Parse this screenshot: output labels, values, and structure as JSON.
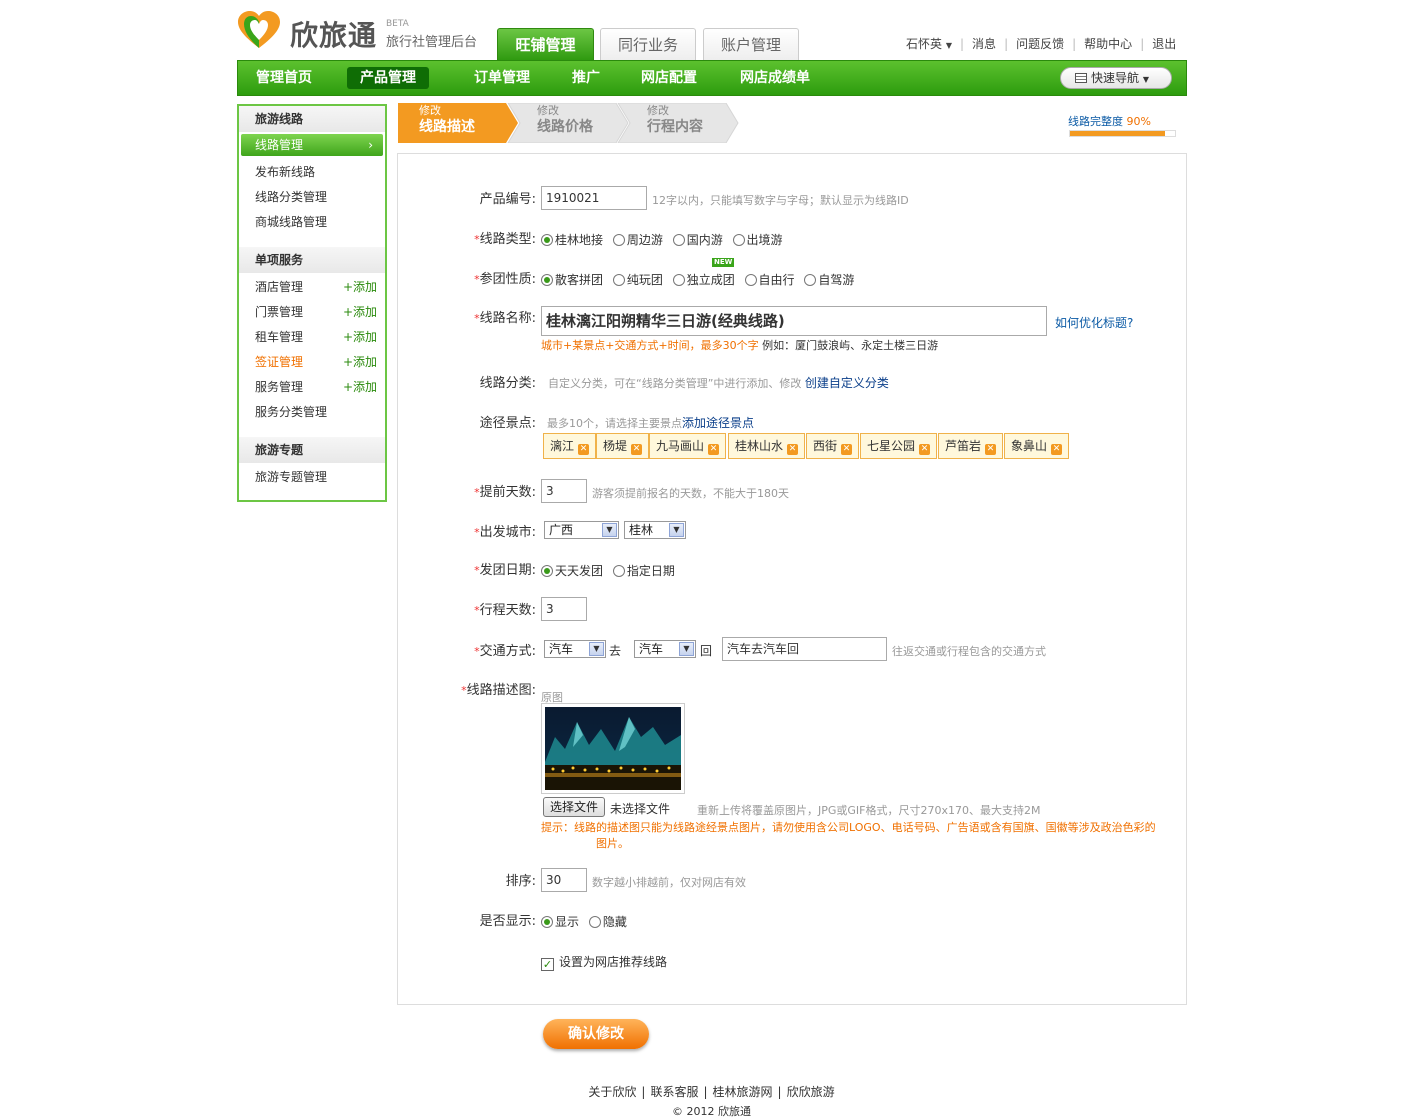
{
  "brand": {
    "logo_text": "欣旅通",
    "beta": "BETA",
    "subtitle": "旅行社管理后台"
  },
  "top_tabs": [
    "旺铺管理",
    "同行业务",
    "账户管理"
  ],
  "top_links": {
    "user": "石怀英",
    "messages": "消息",
    "feedback": "问题反馈",
    "help": "帮助中心",
    "logout": "退出"
  },
  "nav": {
    "items": [
      "管理首页",
      "产品管理",
      "订单管理",
      "推广",
      "网店配置",
      "网店成绩单"
    ],
    "quick_nav": "快速导航"
  },
  "sidebar": {
    "sections": [
      {
        "title": "旅游线路",
        "items": [
          "线路管理",
          "发布新线路",
          "线路分类管理",
          "商城线路管理"
        ]
      },
      {
        "title": "单项服务",
        "items": [
          "酒店管理",
          "门票管理",
          "租车管理",
          "签证管理",
          "服务管理",
          "服务分类管理"
        ],
        "add": "+添加"
      },
      {
        "title": "旅游专题",
        "items": [
          "旅游专题管理"
        ]
      }
    ]
  },
  "steps": [
    {
      "top": "修改",
      "main": "线路描述"
    },
    {
      "top": "修改",
      "main": "线路价格"
    },
    {
      "top": "修改",
      "main": "行程内容"
    }
  ],
  "completion": {
    "label": "线路完整度",
    "value": "90%",
    "fraction": 0.9
  },
  "form": {
    "product_no": {
      "label": "产品编号:",
      "value": "1910021",
      "hint": "12字以内，只能填写数字与字母；默认显示为线路ID"
    },
    "route_type": {
      "label": "线路类型:",
      "options": [
        "桂林地接",
        "周边游",
        "国内游",
        "出境游"
      ],
      "selected": 0
    },
    "group_type": {
      "label": "参团性质:",
      "options": [
        "散客拼团",
        "纯玩团",
        "独立成团",
        "自由行",
        "自驾游"
      ],
      "selected": 0,
      "new_badge": "NEW"
    },
    "route_name": {
      "label": "线路名称:",
      "value": "桂林漓江阳朔精华三日游(经典线路)",
      "help_link": "如何优化标题?",
      "hint_red": "城市+某景点+交通方式+时间，最多30个字",
      "hint_example": "例如：厦门鼓浪屿、永定土楼三日游"
    },
    "category": {
      "label": "线路分类:",
      "hint": "自定义分类，可在“线路分类管理”中进行添加、修改",
      "link": "创建自定义分类"
    },
    "spots": {
      "label": "途径景点:",
      "hint": "最多10个，请选择主要景点",
      "link": "添加途径景点",
      "items": [
        "漓江",
        "杨堤",
        "九马画山",
        "桂林山水",
        "西街",
        "七星公园",
        "芦笛岩",
        "象鼻山"
      ],
      "remove_icon": "✕"
    },
    "advance_days": {
      "label": "提前天数:",
      "value": "3",
      "hint": "游客须提前报名的天数，不能大于180天"
    },
    "departure": {
      "label": "出发城市:",
      "province": "广西",
      "city": "桂林"
    },
    "date": {
      "label": "发团日期:",
      "options": [
        "天天发团",
        "指定日期"
      ],
      "selected": 0
    },
    "days": {
      "label": "行程天数:",
      "value": "3"
    },
    "transport": {
      "label": "交通方式:",
      "go": "汽车",
      "go_suffix": "去",
      "back": "汽车",
      "back_suffix": "回",
      "desc": "汽车去汽车回",
      "hint": "往返交通或行程包含的交通方式"
    },
    "image": {
      "label": "线路描述图:",
      "original": "原图",
      "choose": "选择文件",
      "no_file": "未选择文件",
      "hint": "重新上传将覆盖原图片，JPG或GIF格式，尺寸270x170、最大支持2M",
      "warning": "提示：线路的描述图只能为线路途经景点图片，请勿使用含公司LOGO、电话号码、广告语或含有国旗、国徽等涉及政治色彩的图片。"
    },
    "sort": {
      "label": "排序:",
      "value": "30",
      "hint": "数字越小排越前，仅对网店有效"
    },
    "display": {
      "label": "是否显示:",
      "options": [
        "显示",
        "隐藏"
      ],
      "selected": 0
    },
    "recommend": {
      "label": "设置为网店推荐线路",
      "checked": true
    }
  },
  "confirm_label": "确认修改",
  "footer": {
    "links": [
      "关于欣欣",
      "联系客服",
      "桂林旅游网",
      "欣欣旅游"
    ],
    "copyright": "© 2012 欣旅通"
  }
}
